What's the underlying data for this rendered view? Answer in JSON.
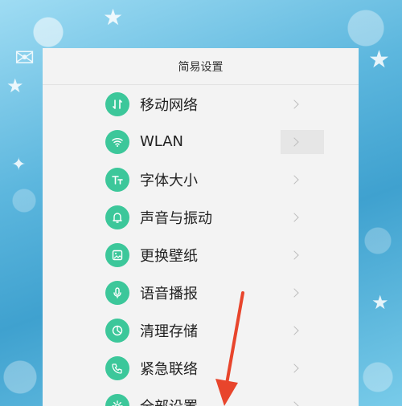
{
  "panel": {
    "title": "简易设置"
  },
  "items": [
    {
      "label": "移动网络",
      "icon": "mobile-network-icon"
    },
    {
      "label": "WLAN",
      "icon": "wifi-icon"
    },
    {
      "label": "字体大小",
      "icon": "font-size-icon"
    },
    {
      "label": "声音与振动",
      "icon": "bell-icon"
    },
    {
      "label": "更换壁纸",
      "icon": "wallpaper-icon"
    },
    {
      "label": "语音播报",
      "icon": "microphone-icon"
    },
    {
      "label": "清理存储",
      "icon": "storage-icon"
    },
    {
      "label": "紧急联络",
      "icon": "emergency-call-icon"
    },
    {
      "label": "全部设置",
      "icon": "gear-icon"
    }
  ],
  "colors": {
    "accent": "#3cc79a",
    "arrow": "#e8452c",
    "panel_bg": "#f3f3f3"
  }
}
